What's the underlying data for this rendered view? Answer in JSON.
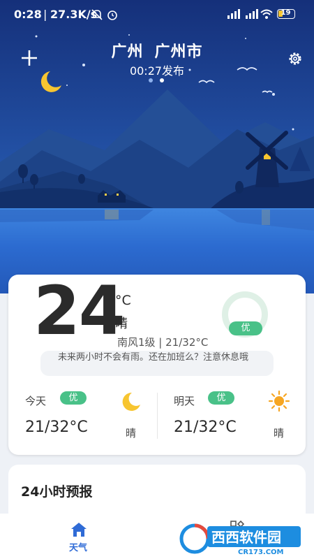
{
  "status_bar": {
    "time": "0:28",
    "separator": "|",
    "net_speed": "27.3K/s",
    "battery": "19"
  },
  "header": {
    "province": "广州",
    "city": "广州市",
    "publish_time": "00:27发布",
    "page_index": 2,
    "page_count": 2
  },
  "current": {
    "temperature": "24",
    "unit": "°C",
    "condition": "晴",
    "wind_range": "南风1级 | 21/32°C",
    "aqi_label": "优",
    "tip": "未来两小时不会有雨。还在加班么？注意休息哦"
  },
  "today": {
    "label": "今天",
    "aqi": "优",
    "range": "21/32°C",
    "condition": "晴",
    "icon": "moon-icon"
  },
  "tomorrow": {
    "label": "明天",
    "aqi": "优",
    "range": "21/32°C",
    "condition": "晴",
    "icon": "sun-icon"
  },
  "forecast": {
    "title": "24小时预报"
  },
  "nav": {
    "weather_label": "天气"
  },
  "watermark": {
    "brand": "西西软件园",
    "domain": "CR173.COM"
  },
  "colors": {
    "sky_top": "#17357e",
    "sky_bottom": "#2a63b8",
    "accent_blue": "#2f6bd6",
    "aqi_green": "#49c188",
    "moon_yellow": "#f7c530",
    "sun_orange": "#f6a623"
  }
}
